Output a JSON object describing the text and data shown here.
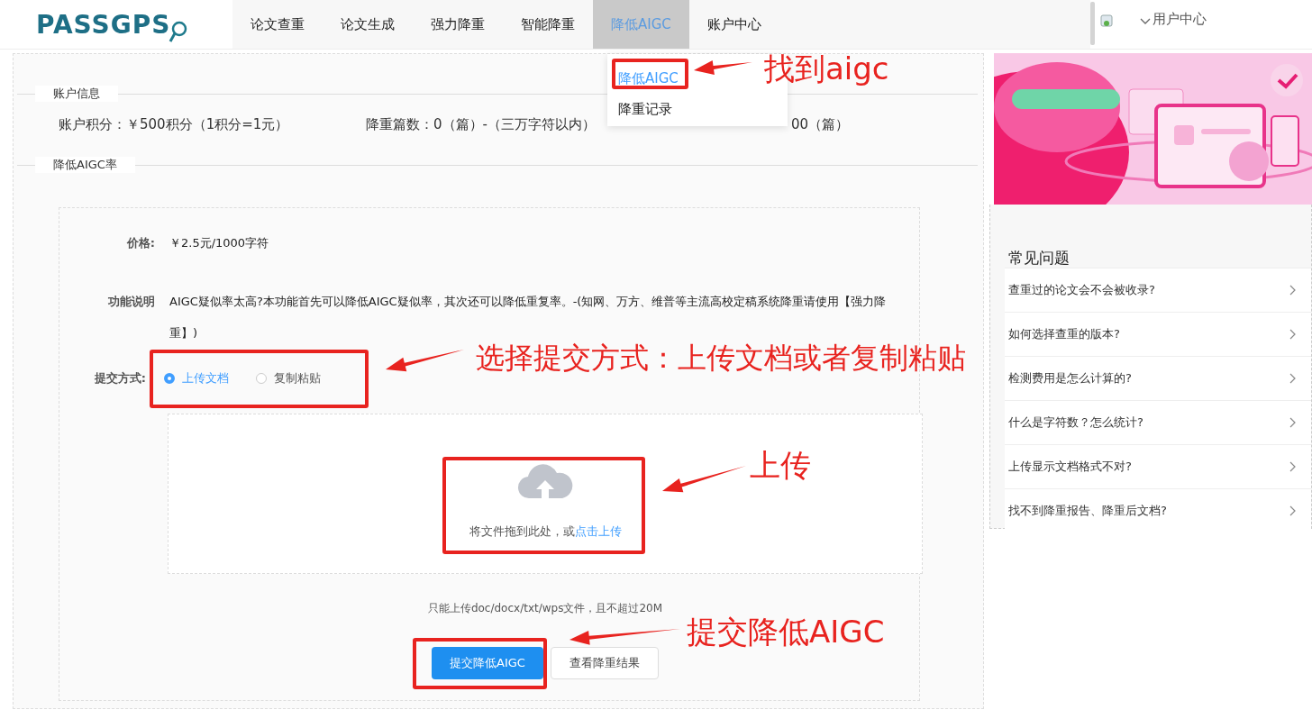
{
  "logo": {
    "text": "PASSGPS"
  },
  "nav": [
    {
      "label": "论文查重",
      "selected": false
    },
    {
      "label": "论文生成",
      "selected": false
    },
    {
      "label": "强力降重",
      "selected": false
    },
    {
      "label": "智能降重",
      "selected": false
    },
    {
      "label": "降低AIGC",
      "selected": true
    },
    {
      "label": "账户中心",
      "selected": false
    }
  ],
  "dropdown": [
    {
      "label": "降低AIGC",
      "selected": true
    },
    {
      "label": "降重记录",
      "selected": false
    }
  ],
  "user_menu": {
    "label": "用户中心"
  },
  "account": {
    "title": "账户信息",
    "stats": [
      "账户积分：￥500积分（1积分=1元）",
      "降重篇数：0（篇）-（三万字符以内）",
      "00（篇）"
    ]
  },
  "aigc": {
    "title": "降低AIGC率",
    "price_label": "价格:",
    "price": "￥2.5元/1000字符",
    "desc_label": "功能说明",
    "desc": "AIGC疑似率太高?本功能首先可以降低AIGC疑似率，其次还可以降低重复率。-(知网、万方、维普等主流高校定稿系统降重请使用【强力降重】)",
    "submit_label": "提交方式:",
    "options": [
      {
        "label": "上传文档",
        "selected": true
      },
      {
        "label": "复制粘贴",
        "selected": false
      }
    ],
    "upload": {
      "text": "将文件拖到此处，或",
      "link": "点击上传"
    },
    "hint": "只能上传doc/docx/txt/wps文件，且不超过20M",
    "buttons": [
      {
        "label": "提交降低AIGC",
        "kind": "primary"
      },
      {
        "label": "查看降重结果",
        "kind": "default"
      }
    ]
  },
  "faq": {
    "title": "常见问题",
    "items": [
      "查重过的论文会不会被收录?",
      "如何选择查重的版本?",
      "检测费用是怎么计算的?",
      "什么是字符数？怎么统计?",
      "上传显示文档格式不对?",
      "找不到降重报告、降重后文档?"
    ]
  },
  "annotations": [
    {
      "text": "找到aigc"
    },
    {
      "text": "选择提交方式：上传文档或者复制粘贴"
    },
    {
      "text": "上传"
    },
    {
      "text": "提交降低AIGC"
    }
  ]
}
